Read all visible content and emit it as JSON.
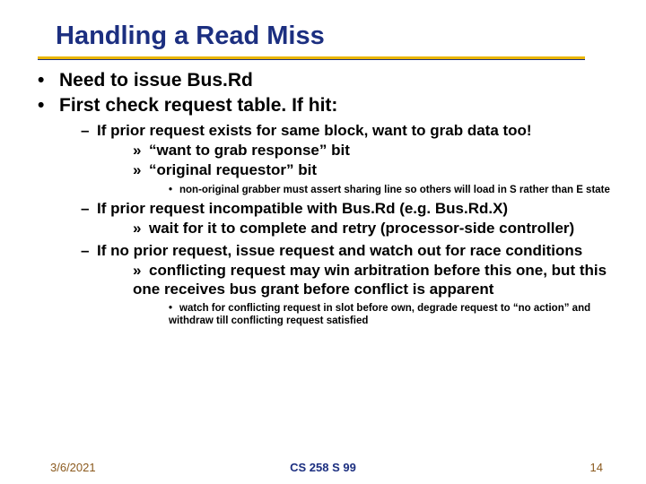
{
  "title": "Handling a Read Miss",
  "body": {
    "p1": "Need to issue Bus.Rd",
    "p2": "First check request table.  If hit:",
    "p2a": "If prior request exists for same block, want to grab data too!",
    "p2a_i": "“want to grab response” bit",
    "p2a_ii": "“original requestor”  bit",
    "p2a_note": "non-original grabber must assert sharing line so others will load in S rather than E state",
    "p2b": "If prior request incompatible with Bus.Rd (e.g. Bus.Rd.X)",
    "p2b_i": "wait for it to complete and retry (processor-side controller)",
    "p2c": "If no prior request, issue request and watch out for race conditions",
    "p2c_i": "conflicting request may win arbitration before this one, but this one receives bus grant before conflict is apparent",
    "p2c_note": "watch for conflicting request in slot before own, degrade request to “no action” and withdraw till conflicting request satisfied"
  },
  "footer": {
    "date": "3/6/2021",
    "course": "CS 258 S 99",
    "page": "14"
  }
}
